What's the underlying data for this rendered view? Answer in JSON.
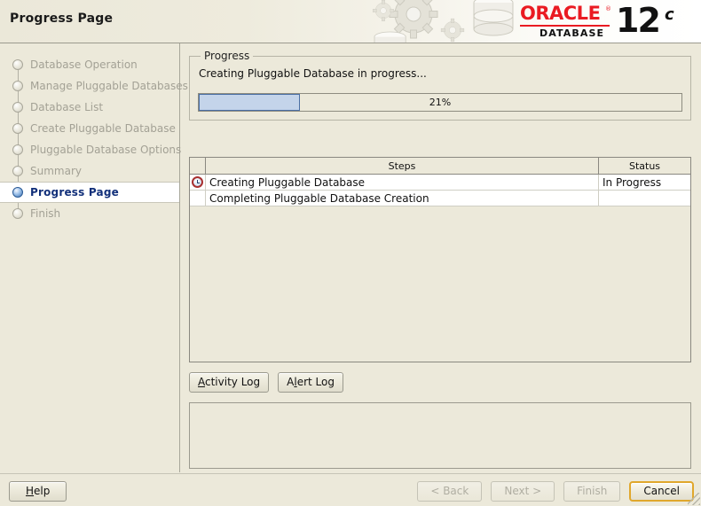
{
  "header": {
    "title": "Progress Page",
    "logo": {
      "brand": "ORACLE",
      "registered": "®",
      "product": "DATABASE",
      "version": "12",
      "edition": "c",
      "brand_color": "#ea1b22",
      "gear_icon": "gear-icon",
      "database-cylinder_icon": "database-cylinder-icon"
    }
  },
  "sidebar": {
    "items": [
      {
        "label": "Database Operation",
        "state": "done"
      },
      {
        "label": "Manage Pluggable Databases",
        "state": "done"
      },
      {
        "label": "Database List",
        "state": "done"
      },
      {
        "label": "Create Pluggable Database",
        "state": "done"
      },
      {
        "label": "Pluggable Database Options",
        "state": "done"
      },
      {
        "label": "Summary",
        "state": "done"
      },
      {
        "label": "Progress Page",
        "state": "active"
      },
      {
        "label": "Finish",
        "state": "pending"
      }
    ]
  },
  "main": {
    "progress_group": {
      "legend": "Progress",
      "status_text": "Creating Pluggable Database in progress...",
      "percent_label": "21%",
      "percent_value": 21,
      "fill_color": "#c4d4ea",
      "fill_border_color": "#4a6fa5"
    },
    "steps_table": {
      "columns": [
        "",
        "Steps",
        "Status"
      ],
      "rows": [
        {
          "icon": "clock-icon",
          "step": "Creating Pluggable Database",
          "status": "In Progress"
        },
        {
          "icon": "",
          "step": "Completing Pluggable Database Creation",
          "status": ""
        }
      ]
    },
    "log_buttons": [
      {
        "label": "Activity Log",
        "mnemonic_index": 0
      },
      {
        "label": "Alert Log",
        "mnemonic_index": 1
      }
    ],
    "log_panel": {
      "text": ""
    }
  },
  "footer": {
    "help_label": "Help",
    "back_label": "< Back",
    "next_label": "Next >",
    "finish_label": "Finish",
    "cancel_label": "Cancel",
    "focus_color": "#e0a72c"
  }
}
